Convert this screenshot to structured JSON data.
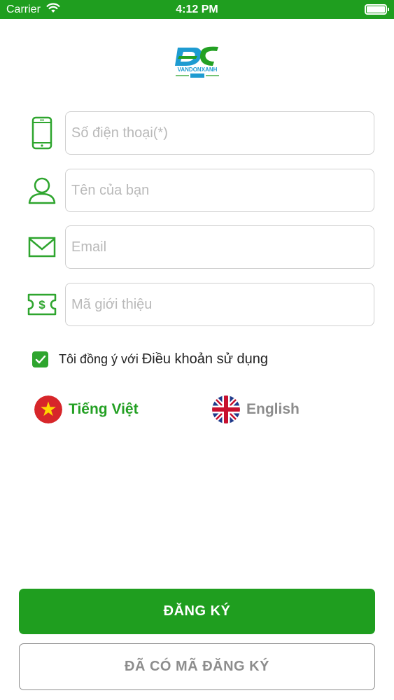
{
  "status_bar": {
    "carrier": "Carrier",
    "time": "4:12 PM",
    "battery_level": 1.0
  },
  "logo": {
    "alt": "VANDONXANH"
  },
  "form": {
    "phone": {
      "placeholder": "Số điện thoại(*)",
      "value": "",
      "icon": "phone-icon"
    },
    "name": {
      "placeholder": "Tên của bạn",
      "value": "",
      "icon": "user-icon"
    },
    "email": {
      "placeholder": "Email",
      "value": "",
      "icon": "mail-icon"
    },
    "referral": {
      "placeholder": "Mã giới thiệu",
      "value": "",
      "icon": "voucher-icon"
    }
  },
  "terms": {
    "checked": true,
    "text": "Tôi đồng ý với",
    "link": "Điều khoản sử dụng"
  },
  "languages": {
    "vietnamese": {
      "label": "Tiếng Việt",
      "selected": true
    },
    "english": {
      "label": "English",
      "selected": false
    }
  },
  "buttons": {
    "register": "ĐĂNG KÝ",
    "have_code": "ĐÃ CÓ MÃ ĐĂNG KÝ"
  },
  "colors": {
    "brand_green": "#1f9e1f",
    "icon_green": "#2ea52e",
    "muted_gray": "#8d8d8d"
  }
}
